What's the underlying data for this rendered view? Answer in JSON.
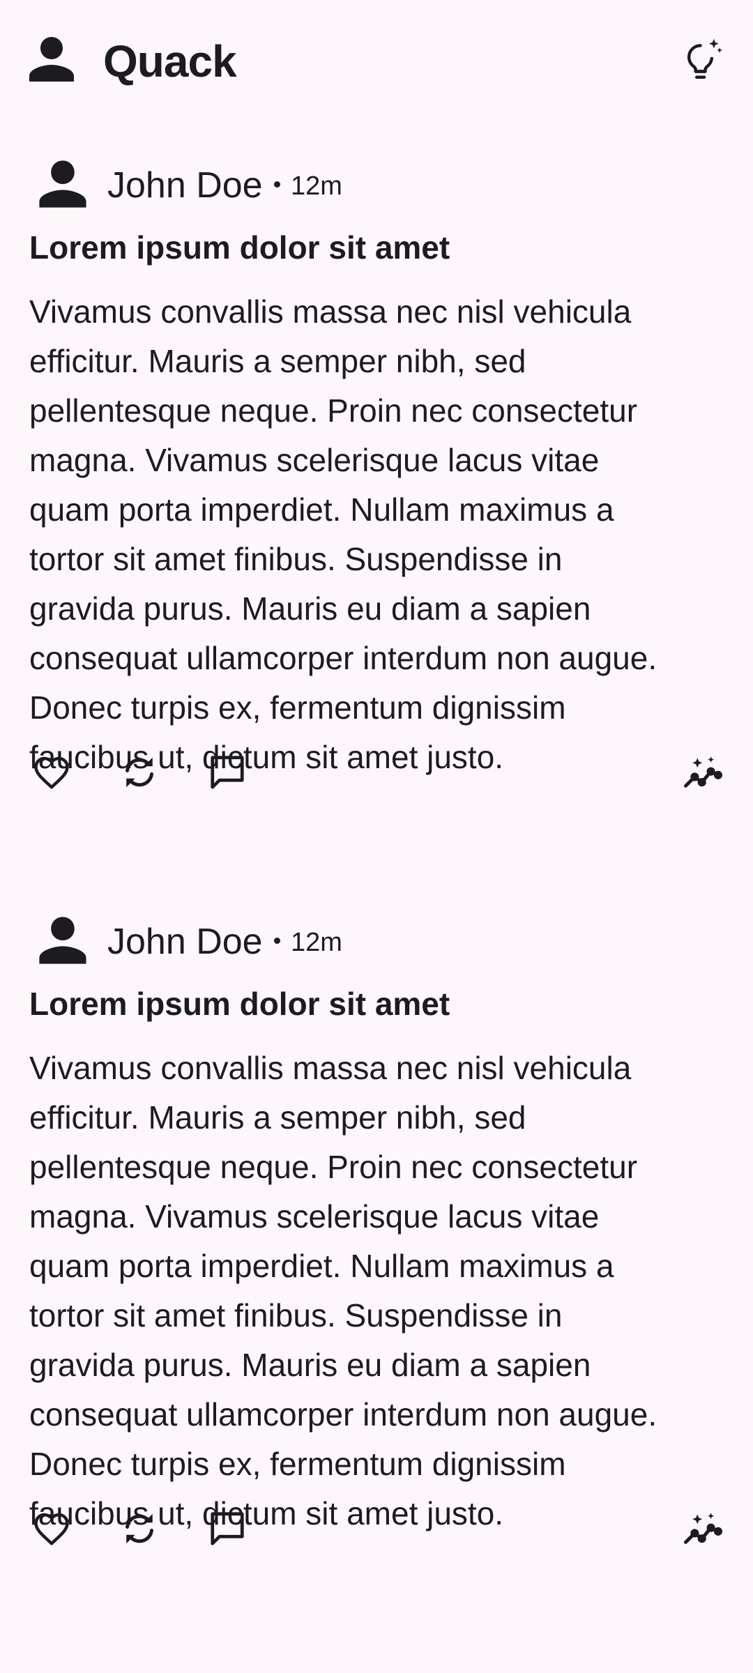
{
  "app": {
    "title": "Quack",
    "avatar_icon": "person-icon",
    "action_icon": "lightbulb-sparkle-icon"
  },
  "posts": [
    {
      "author": "John Doe",
      "time": "12m",
      "title": "Lorem ipsum dolor sit amet",
      "body_lines": [
        "Vivamus convallis massa nec nisl vehicula",
        "efficitur. Mauris a semper nibh, sed",
        "pellentesque neque. Proin nec consectetur",
        "magna. Vivamus scelerisque lacus vitae",
        "quam porta imperdiet. Nullam maximus a",
        "tortor sit amet finibus. Suspendisse in",
        "gravida purus. Mauris eu diam a sapien",
        "consequat ullamcorper interdum non augue.",
        "Donec turpis ex, fermentum dignissim",
        "faucibus ut, dictum sit amet justo."
      ],
      "actions": [
        "heart-icon",
        "repost-icon",
        "comment-icon",
        "insights-icon"
      ]
    },
    {
      "author": "John Doe",
      "time": "12m",
      "title": "Lorem ipsum dolor sit amet",
      "body_lines": [
        "Vivamus convallis massa nec nisl vehicula",
        "efficitur. Mauris a semper nibh, sed",
        "pellentesque neque. Proin nec consectetur",
        "magna. Vivamus scelerisque lacus vitae",
        "quam porta imperdiet. Nullam maximus a",
        "tortor sit amet finibus. Suspendisse in",
        "gravida purus. Mauris eu diam a sapien",
        "consequat ullamcorper interdum non augue.",
        "Donec turpis ex, fermentum dignissim",
        "faucibus ut, dictum sit amet justo."
      ],
      "actions": [
        "heart-icon",
        "repost-icon",
        "comment-icon",
        "insights-icon"
      ]
    }
  ],
  "colors": {
    "background": "#fdf7fc",
    "text": "#1c1b1f"
  }
}
